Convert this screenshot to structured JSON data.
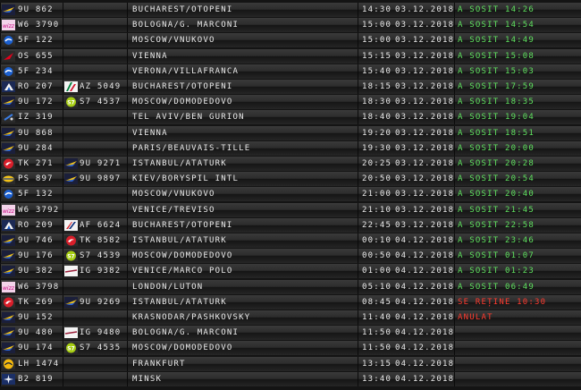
{
  "flights": [
    {
      "logo": "blue-air-logo",
      "code": "9U 862",
      "code2": "",
      "logo2": "",
      "dest": "BUCHAREST/OTOPENI",
      "time": "14:30",
      "date": "03.12.2018",
      "status": "A SOSIT 14:26",
      "status_type": "arrived"
    },
    {
      "logo": "wizz-air-logo",
      "code": "W6 3790",
      "code2": "",
      "logo2": "",
      "dest": "BOLOGNA/G. MARCONI",
      "time": "15:00",
      "date": "03.12.2018",
      "status": "A SOSIT 14:54",
      "status_type": "arrived"
    },
    {
      "logo": "pobeda-logo",
      "code": "5F 122",
      "code2": "",
      "logo2": "",
      "dest": "MOSCOW/VNUKOVO",
      "time": "15:00",
      "date": "03.12.2018",
      "status": "A SOSIT 14:49",
      "status_type": "arrived"
    },
    {
      "logo": "austrian-logo",
      "code": "OS 655",
      "code2": "",
      "logo2": "",
      "dest": "VIENNA",
      "time": "15:15",
      "date": "03.12.2018",
      "status": "A SOSIT 15:08",
      "status_type": "arrived"
    },
    {
      "logo": "pobeda-logo",
      "code": "5F 234",
      "code2": "",
      "logo2": "",
      "dest": "VERONA/VILLAFRANCA",
      "time": "15:40",
      "date": "03.12.2018",
      "status": "A SOSIT 15:03",
      "status_type": "arrived"
    },
    {
      "logo": "tarom-logo",
      "code": "RO 207",
      "code2": "AZ 5049",
      "logo2": "alitalia-logo",
      "dest": "BUCHAREST/OTOPENI",
      "time": "18:15",
      "date": "03.12.2018",
      "status": "A SOSIT 17:59",
      "status_type": "arrived"
    },
    {
      "logo": "blue-air-logo",
      "code": "9U 172",
      "code2": "S7 4537",
      "logo2": "s7-logo",
      "dest": "MOSCOW/DOMODEDOVO",
      "time": "18:30",
      "date": "03.12.2018",
      "status": "A SOSIT 18:35",
      "status_type": "arrived"
    },
    {
      "logo": "israir-logo",
      "code": "IZ 319",
      "code2": "",
      "logo2": "",
      "dest": "TEL AVIV/BEN GURION",
      "time": "18:40",
      "date": "03.12.2018",
      "status": "A SOSIT 19:04",
      "status_type": "arrived"
    },
    {
      "logo": "blue-air-logo",
      "code": "9U 868",
      "code2": "",
      "logo2": "",
      "dest": "VIENNA",
      "time": "19:20",
      "date": "03.12.2018",
      "status": "A SOSIT 18:51",
      "status_type": "arrived"
    },
    {
      "logo": "blue-air-logo",
      "code": "9U 284",
      "code2": "",
      "logo2": "",
      "dest": "PARIS/BEAUVAIS-TILLE",
      "time": "19:30",
      "date": "03.12.2018",
      "status": "A SOSIT 20:00",
      "status_type": "arrived"
    },
    {
      "logo": "turkish-logo",
      "code": "TK 271",
      "code2": "9U 9271",
      "logo2": "blue-air-logo",
      "dest": "ISTANBUL/ATATURK",
      "time": "20:25",
      "date": "03.12.2018",
      "status": "A SOSIT 20:28",
      "status_type": "arrived"
    },
    {
      "logo": "uia-logo",
      "code": "PS 897",
      "code2": "9U 9897",
      "logo2": "blue-air-logo",
      "dest": "KIEV/BORYSPIL INTL",
      "time": "20:50",
      "date": "03.12.2018",
      "status": "A SOSIT 20:54",
      "status_type": "arrived"
    },
    {
      "logo": "pobeda-logo",
      "code": "5F 132",
      "code2": "",
      "logo2": "",
      "dest": "MOSCOW/VNUKOVO",
      "time": "21:00",
      "date": "03.12.2018",
      "status": "A SOSIT 20:40",
      "status_type": "arrived"
    },
    {
      "logo": "wizz-air-logo",
      "code": "W6 3792",
      "code2": "",
      "logo2": "",
      "dest": "VENICE/TREVISO",
      "time": "21:10",
      "date": "03.12.2018",
      "status": "A SOSIT 21:45",
      "status_type": "arrived"
    },
    {
      "logo": "tarom-logo",
      "code": "RO 209",
      "code2": "AF 6624",
      "logo2": "air-france-logo",
      "dest": "BUCHAREST/OTOPENI",
      "time": "22:45",
      "date": "03.12.2018",
      "status": "A SOSIT 22:58",
      "status_type": "arrived"
    },
    {
      "logo": "blue-air-logo",
      "code": "9U 746",
      "code2": "TK 8582",
      "logo2": "turkish-logo",
      "dest": "ISTANBUL/ATATURK",
      "time": "00:10",
      "date": "04.12.2018",
      "status": "A SOSIT 23:46",
      "status_type": "arrived"
    },
    {
      "logo": "blue-air-logo",
      "code": "9U 176",
      "code2": "S7 4539",
      "logo2": "s7-logo",
      "dest": "MOSCOW/DOMODEDOVO",
      "time": "00:50",
      "date": "04.12.2018",
      "status": "A SOSIT 01:07",
      "status_type": "arrived"
    },
    {
      "logo": "blue-air-logo",
      "code": "9U 382",
      "code2": "IG 9382",
      "logo2": "meridiana-logo",
      "dest": "VENICE/MARCO POLO",
      "time": "01:00",
      "date": "04.12.2018",
      "status": "A SOSIT 01:23",
      "status_type": "arrived"
    },
    {
      "logo": "wizz-air-logo",
      "code": "W6 3798",
      "code2": "",
      "logo2": "",
      "dest": "LONDON/LUTON",
      "time": "05:10",
      "date": "04.12.2018",
      "status": "A SOSIT 06:49",
      "status_type": "arrived"
    },
    {
      "logo": "turkish-logo",
      "code": "TK 269",
      "code2": "9U 9269",
      "logo2": "blue-air-logo",
      "dest": "ISTANBUL/ATATURK",
      "time": "08:45",
      "date": "04.12.2018",
      "status": "SE REȚINE 10:30",
      "status_type": "delayed"
    },
    {
      "logo": "blue-air-logo",
      "code": "9U 152",
      "code2": "",
      "logo2": "",
      "dest": "KRASNODAR/PASHKOVSKY",
      "time": "11:40",
      "date": "04.12.2018",
      "status": "ANULAT",
      "status_type": "cancelled"
    },
    {
      "logo": "blue-air-logo",
      "code": "9U 480",
      "code2": "IG 9480",
      "logo2": "meridiana-logo",
      "dest": "BOLOGNA/G. MARCONI",
      "time": "11:50",
      "date": "04.12.2018",
      "status": "",
      "status_type": "scheduled"
    },
    {
      "logo": "blue-air-logo",
      "code": "9U 174",
      "code2": "S7 4535",
      "logo2": "s7-logo",
      "dest": "MOSCOW/DOMODEDOVO",
      "time": "11:50",
      "date": "04.12.2018",
      "status": "",
      "status_type": "scheduled"
    },
    {
      "logo": "lufthansa-logo",
      "code": "LH 1474",
      "code2": "",
      "logo2": "",
      "dest": "FRANKFURT",
      "time": "13:15",
      "date": "04.12.2018",
      "status": "",
      "status_type": "scheduled"
    },
    {
      "logo": "belavia-logo",
      "code": "B2 819",
      "code2": "",
      "logo2": "",
      "dest": "MINSK",
      "time": "13:40",
      "date": "04.12.2018",
      "status": "",
      "status_type": "scheduled"
    }
  ],
  "colors": {
    "arrived": "#5fe05f",
    "delayed": "#ff3b2f",
    "cancelled": "#ff3b2f",
    "scheduled": "#e9e9e9",
    "text": "#e9e9e9"
  }
}
